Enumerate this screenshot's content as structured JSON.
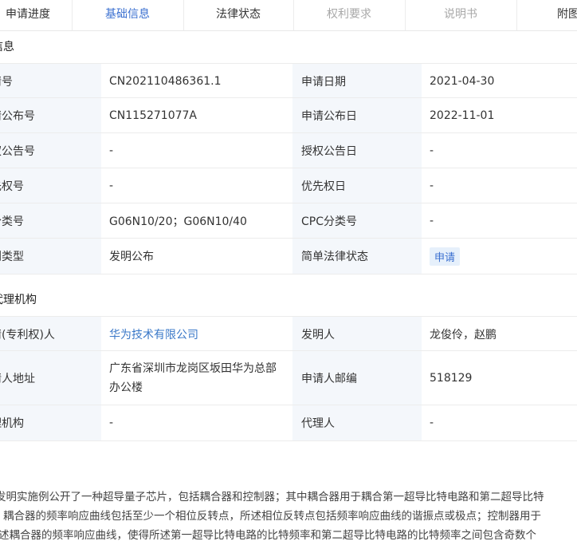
{
  "tabs": [
    {
      "label": "申请进度",
      "state": "normal"
    },
    {
      "label": "基础信息",
      "state": "active"
    },
    {
      "label": "法律状态",
      "state": "normal"
    },
    {
      "label": "权利要求",
      "state": "disabled"
    },
    {
      "label": "说明书",
      "state": "disabled"
    },
    {
      "label": "附图",
      "state": "normal"
    }
  ],
  "section_basic": {
    "title": "信息"
  },
  "basic_rows": [
    {
      "l1": "请号",
      "v1": "CN202110486361.1",
      "l2": "申请日期",
      "v2": "2021-04-30"
    },
    {
      "l1": "请公布号",
      "v1": "CN115271077A",
      "l2": "申请公布日",
      "v2": "2022-11-01"
    },
    {
      "l1": "权公告号",
      "v1": "-",
      "l2": "授权公告日",
      "v2": "-"
    },
    {
      "l1": "先权号",
      "v1": "-",
      "l2": "优先权日",
      "v2": "-"
    },
    {
      "l1": "分类号",
      "v1": "G06N10/20；G06N10/40",
      "l2": "CPC分类号",
      "v2": "-"
    },
    {
      "l1": "利类型",
      "v1": "发明公布",
      "l2": "简单法律状态",
      "v2": "申请"
    }
  ],
  "section_agency": {
    "title": "代理机构"
  },
  "agency_rows": [
    {
      "l1": "请(专利权)人",
      "v1": "华为技术有限公司",
      "l2": "发明人",
      "v2": "龙俊伶，赵鹏"
    },
    {
      "l1": "请人地址",
      "v1": "广东省深圳市龙岗区坂田华为总部办公楼",
      "l2": "申请人邮编",
      "v2": "518129"
    },
    {
      "l1": "理机构",
      "v1": "-",
      "l2": "代理人",
      "v2": "-"
    }
  ],
  "abstract_lines": [
    "发明实施例公开了一种超导量子芯片，包括耦合器和控制器；其中耦合器用于耦合第一超导比特电路和第二超导比特",
    "耦合器的频率响应曲线包括至少一个相位反转点，所述相位反转点包括频率响应曲线的谐振点或极点；控制器用于",
    "述耦合器的频率响应曲线，使得所述第一超导比特电路的比特频率和第二超导比特电路的比特频率之间包含奇数个"
  ],
  "colors": {
    "accent": "#3a6fd0",
    "label_bg": "#f4f7fb",
    "border": "#ececec"
  }
}
